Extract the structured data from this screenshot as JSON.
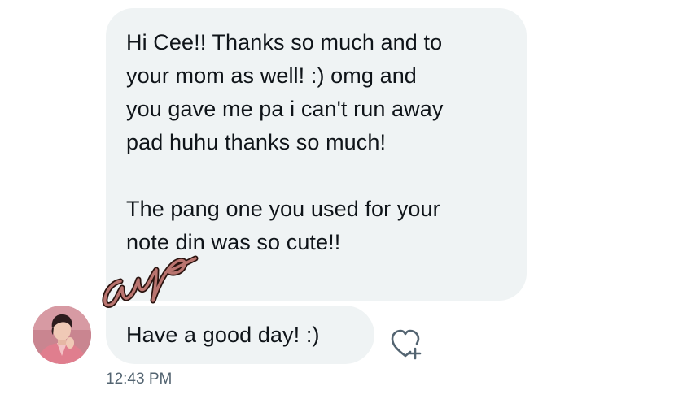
{
  "conversation": {
    "messages": [
      {
        "lines": [
          "Hi Cee!! Thanks so much and to",
          "your mom as well! :) omg and",
          "you gave me pa i can't run away",
          "pad huhu thanks so much!",
          "",
          "The pang one you used for your",
          "note din was so cute!!"
        ]
      },
      {
        "lines": [
          "Have a good day! :)"
        ]
      }
    ],
    "timestamp": "12:43 PM"
  },
  "icons": {
    "react": "heart-plus-icon",
    "scribble": "handwritten-scribble"
  },
  "colors": {
    "bubble": "#eff3f4",
    "text": "#0f1419",
    "timestamp": "#536471",
    "scribble_fill": "#b9746f",
    "scribble_outline": "#2b1410"
  }
}
